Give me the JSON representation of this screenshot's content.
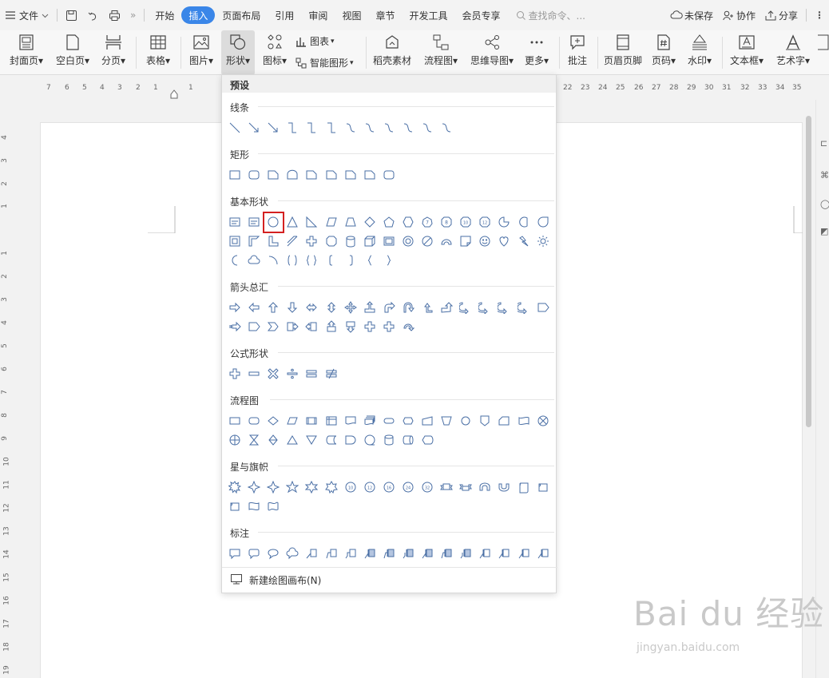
{
  "topbar": {
    "menu_label": "文件",
    "tabs": [
      "开始",
      "插入",
      "页面布局",
      "引用",
      "审阅",
      "视图",
      "章节",
      "开发工具",
      "会员专享"
    ],
    "active_tab": "插入",
    "search_placeholder": "查找命令、...",
    "unsaved_label": "未保存",
    "collab_label": "协作",
    "share_label": "分享"
  },
  "ribbon": {
    "cover_page": "封面页",
    "blank_page": "空白页",
    "page_break": "分页",
    "table": "表格",
    "picture": "图片",
    "shape": "形状",
    "icon": "图标",
    "chart": "图表",
    "smart_art": "智能图形",
    "material": "稻壳素材",
    "flowchart": "流程图",
    "mindmap": "思维导图",
    "more": "更多",
    "comment": "批注",
    "header_footer": "页眉页脚",
    "page_number": "页码",
    "watermark": "水印",
    "textbox": "文本框",
    "wordart": "艺术字"
  },
  "ruler": {
    "h_ticks": [
      "7",
      "6",
      "5",
      "4",
      "3",
      "2",
      "1",
      "",
      "1",
      "2",
      "22",
      "23",
      "24",
      "25",
      "26",
      "27",
      "28",
      "29",
      "30",
      "31",
      "32",
      "33",
      "34",
      "35"
    ],
    "v_ticks": [
      "4",
      "3",
      "2",
      "1",
      "",
      "1",
      "2",
      "3",
      "4",
      "5",
      "6",
      "7",
      "8",
      "9",
      "10",
      "11",
      "12",
      "13",
      "14",
      "15",
      "16",
      "17",
      "18",
      "19"
    ]
  },
  "dropdown": {
    "title": "预设",
    "sections": [
      "线条",
      "矩形",
      "基本形状",
      "箭头总汇",
      "公式形状",
      "流程图",
      "星与旗帜",
      "标注"
    ],
    "footer": "新建绘图画布(N)",
    "highlighted_shape": "ellipse"
  },
  "watermark": {
    "brand": "Bai du 经验",
    "url": "jingyan.baidu.com"
  },
  "colors": {
    "accent": "#3a86e8",
    "shape_stroke": "#4a6fa5",
    "highlight": "#d42020"
  }
}
